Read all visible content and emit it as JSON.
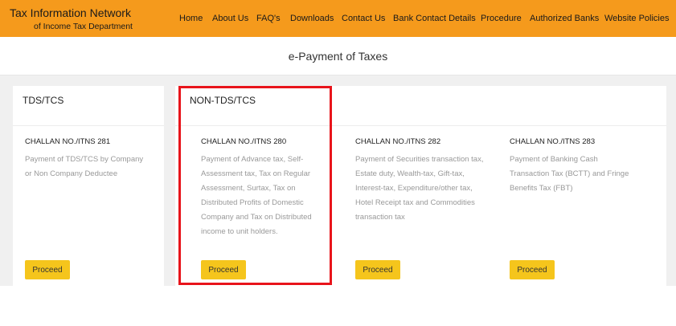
{
  "header": {
    "title": "Tax Information Network",
    "subtitle": "of Income Tax Department",
    "nav": [
      "Home",
      "About Us",
      "FAQ's",
      "Downloads",
      "Contact Us",
      "Bank Contact Details",
      "Procedure",
      "Authorized Banks",
      "Website Policies"
    ]
  },
  "page_title": "e-Payment of Taxes",
  "categories": {
    "tds": "TDS/TCS",
    "non_tds": "NON-TDS/TCS"
  },
  "challans": [
    {
      "number": "CHALLAN NO./ITNS 281",
      "lines": [
        "Payment of TDS/TCS by Company",
        "or Non Company Deductee"
      ],
      "button": "Proceed"
    },
    {
      "number": "CHALLAN NO./ITNS 280",
      "lines": [
        "Payment of Advance tax, Self-",
        "Assessment tax, Tax on Regular",
        "Assessment, Surtax, Tax on",
        "Distributed Profits of Domestic",
        "Company and Tax on Distributed",
        "income to unit holders."
      ],
      "button": "Proceed"
    },
    {
      "number": "CHALLAN NO./ITNS 282",
      "lines": [
        "Payment of Securities transaction tax,",
        "Estate duty, Wealth-tax, Gift-tax,",
        "Interest-tax, Expenditure/other tax,",
        "Hotel Receipt tax and Commodities",
        "transaction tax"
      ],
      "button": "Proceed"
    },
    {
      "number": "CHALLAN NO./ITNS 283",
      "lines": [
        "Payment of Banking Cash",
        "Transaction Tax (BCTT) and Fringe",
        "Benefits Tax (FBT)"
      ],
      "button": "Proceed"
    }
  ],
  "colors": {
    "header_bg": "#f59a1c",
    "button_bg": "#f5c51c",
    "highlight": "#e8141b"
  }
}
